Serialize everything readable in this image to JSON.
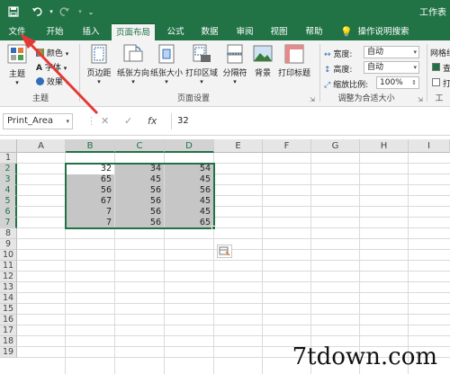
{
  "titlebar": {
    "save_icon": "save-icon",
    "undo_icon": "undo-icon",
    "redo_icon": "redo-icon",
    "customize_icon": "customize-qat-icon",
    "doc_title": "工作表"
  },
  "tabs": [
    "文件",
    "开始",
    "插入",
    "页面布局",
    "公式",
    "数据",
    "审阅",
    "视图",
    "帮助",
    "操作说明搜索"
  ],
  "active_tab": "页面布局",
  "ribbon": {
    "themes": {
      "theme_label": "主题",
      "colors_label": "颜色",
      "fonts_label": "字体",
      "effects_label": "效果",
      "group_label": "主题"
    },
    "page_setup": {
      "margins": "页边距",
      "orientation": "纸张方向",
      "size": "纸张大小",
      "print_area": "打印区域",
      "breaks": "分隔符",
      "background": "背景",
      "print_titles": "打印标题",
      "group_label": "页面设置"
    },
    "scale_to_fit": {
      "width_label": "宽度:",
      "width_value": "自动",
      "height_label": "高度:",
      "height_value": "自动",
      "scale_label": "缩放比例:",
      "scale_value": "100%",
      "group_label": "调整为合适大小"
    },
    "sheet_options": {
      "gridlines_label": "网格线",
      "view_char": "查",
      "print_char": "打",
      "group_label": "工"
    }
  },
  "formula_bar": {
    "name_box": "Print_Area",
    "cancel": "✕",
    "enter": "✓",
    "fx": "fx",
    "value": "32"
  },
  "sheet": {
    "columns": [
      "A",
      "B",
      "C",
      "D",
      "E",
      "F",
      "G",
      "H",
      "I"
    ],
    "selected_columns": [
      "B",
      "C",
      "D"
    ],
    "rows": [
      "1",
      "2",
      "3",
      "4",
      "5",
      "6",
      "7",
      "8",
      "9",
      "10",
      "11",
      "12",
      "13",
      "14",
      "15",
      "16",
      "17",
      "18",
      "19"
    ],
    "selected_rows": [
      "2",
      "3",
      "4",
      "5",
      "6",
      "7"
    ],
    "data": [
      [
        "32",
        "34",
        "54"
      ],
      [
        "65",
        "45",
        "45"
      ],
      [
        "56",
        "56",
        "56"
      ],
      [
        "67",
        "56",
        "45"
      ],
      [
        "7",
        "56",
        "45"
      ],
      [
        "7",
        "56",
        "65"
      ]
    ]
  },
  "watermark": "7tdown.com",
  "colors": {
    "accent": "#217346",
    "shade": "#c6c6c6",
    "arrow": "#e53935"
  }
}
